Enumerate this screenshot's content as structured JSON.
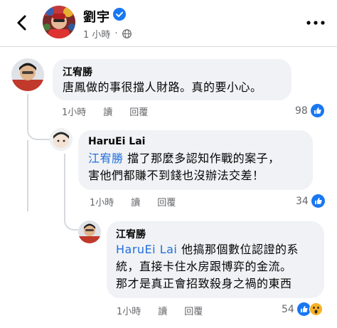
{
  "header": {
    "author": "劉宇",
    "time": "1 小時",
    "icons": {
      "back": "back-arrow-icon",
      "verified": "verified-badge-icon",
      "audience": "globe-icon",
      "more": "more-options-icon"
    }
  },
  "comments": [
    {
      "author": "江宥勝",
      "mention": "",
      "lines": [
        "唐鳳做的事很擋人財路。真的要小心。"
      ],
      "time": "1小時",
      "see": "讀",
      "reply": "回覆",
      "reactions": "98",
      "reaction_icons": [
        "like-icon"
      ]
    },
    {
      "author": "HaruEi Lai",
      "mention": "江宥勝",
      "lines": [
        "擋了那麼多認知作戰的案子，",
        "害他們都賺不到錢也沒辦法交差！"
      ],
      "time": "1小時",
      "see": "讀",
      "reply": "回覆",
      "reactions": "34",
      "reaction_icons": [
        "like-icon"
      ]
    },
    {
      "author": "江宥勝",
      "mention": "HaruEi Lai",
      "lines": [
        "他搞那個數位認證的系",
        "統，直接卡住水房跟博弈的金流。",
        "那才是真正會招致殺身之禍的東西"
      ],
      "time": "1小時",
      "see": "讀",
      "reply": "回覆",
      "reactions": "54",
      "reaction_icons": [
        "like-icon",
        "wow-icon"
      ]
    }
  ],
  "colors": {
    "link": "#216fdb",
    "bubble": "#f0f2f5",
    "meta": "#65676b",
    "like": "#1877f2",
    "wow": "#f7b125"
  }
}
